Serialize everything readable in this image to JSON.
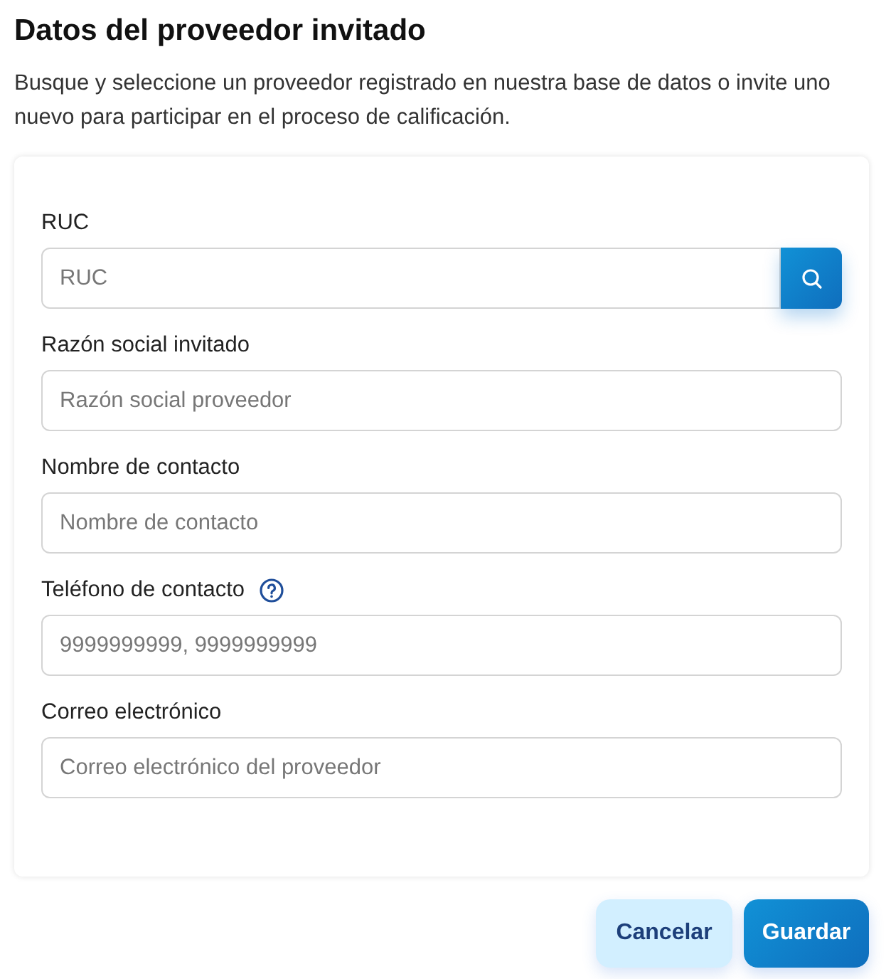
{
  "title": "Datos del proveedor invitado",
  "description": "Busque y seleccione un proveedor registrado en nuestra base de datos o invite uno nuevo para participar en el proceso de calificación.",
  "fields": [
    {
      "kind": "search",
      "label": "RUC",
      "placeholder": "RUC",
      "help": false
    },
    {
      "kind": "text",
      "label": "Razón social invitado",
      "placeholder": "Razón social proveedor",
      "help": false
    },
    {
      "kind": "text",
      "label": "Nombre de contacto",
      "placeholder": "Nombre de contacto",
      "help": false
    },
    {
      "kind": "text",
      "label": "Teléfono de contacto",
      "placeholder": "9999999999, 9999999999",
      "help": true
    },
    {
      "kind": "text",
      "label": "Correo electrónico",
      "placeholder": "Correo electrónico del proveedor",
      "help": false
    }
  ],
  "buttons": [
    {
      "kind": "secondary",
      "label": "Cancelar"
    },
    {
      "kind": "primary",
      "label": "Guardar"
    }
  ]
}
